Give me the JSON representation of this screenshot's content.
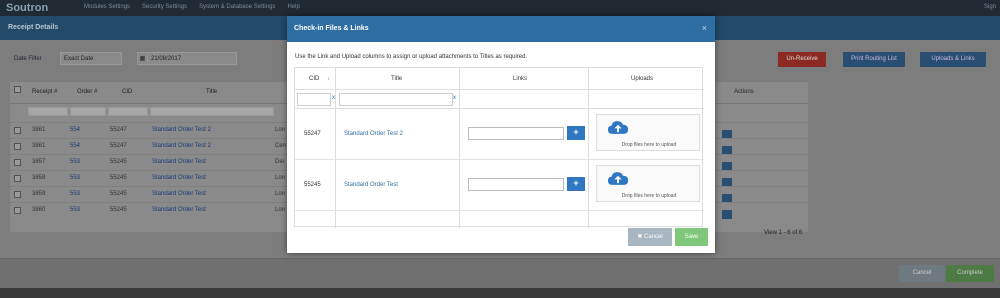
{
  "topnav": {
    "brand": "Soutron",
    "items": [
      "Modules Settings",
      "Security Settings",
      "System & Database Settings",
      "Help"
    ],
    "signin": "Sign"
  },
  "receipt": {
    "title": "Receipt Details",
    "date_filter_label": "Date Filter",
    "date_filter_value": "Exact Date",
    "date_value": "21/08/2017",
    "buttons": {
      "unreceive": "Un-Receive",
      "print": "Print Routing List",
      "uploads": "Uploads & Links"
    },
    "columns": [
      "Receipt #",
      "Order #",
      "CID",
      "Title"
    ],
    "actions_header": "Actions",
    "rows": [
      {
        "receipt": "3861",
        "order": "554",
        "cid": "55247",
        "title": "Standard Order Test 2",
        "extra": "Lon"
      },
      {
        "receipt": "3861",
        "order": "554",
        "cid": "55247",
        "title": "Standard Order Test 2",
        "extra": "Cen"
      },
      {
        "receipt": "3857",
        "order": "553",
        "cid": "55245",
        "title": "Standard Order Test",
        "extra": "Dei"
      },
      {
        "receipt": "3858",
        "order": "553",
        "cid": "55245",
        "title": "Standard Order Test",
        "extra": "Lon"
      },
      {
        "receipt": "3859",
        "order": "553",
        "cid": "55245",
        "title": "Standard Order Test",
        "extra": "Lon"
      },
      {
        "receipt": "3860",
        "order": "553",
        "cid": "55245",
        "title": "Standard Order Test",
        "extra": "Lon"
      }
    ],
    "pager": "View 1 - 6 of 6",
    "cancel": "Cancel",
    "complete": "Complete"
  },
  "modal": {
    "title": "Check-in Files & Links",
    "close": "×",
    "description": "Use the Link and Upload columns to assign or upload attachments to Titles as required.",
    "columns": {
      "cid": "CID",
      "title": "Title",
      "links": "Links",
      "uploads": "Uploads"
    },
    "filter_clear": "x",
    "rows": [
      {
        "cid": "55247",
        "title": "Standard Order Test 2",
        "drop_text": "Drop files here to upload",
        "plus": "+"
      },
      {
        "cid": "55245",
        "title": "Standard Order Test",
        "drop_text": "Drop files here to upload",
        "plus": "+"
      }
    ],
    "cancel": "✖ Cancel",
    "save": "Save"
  },
  "colors": {
    "header": "#2f6ea3",
    "save": "#7fc77a",
    "cancel": "#a7b6c0",
    "plus": "#2f77c2"
  }
}
